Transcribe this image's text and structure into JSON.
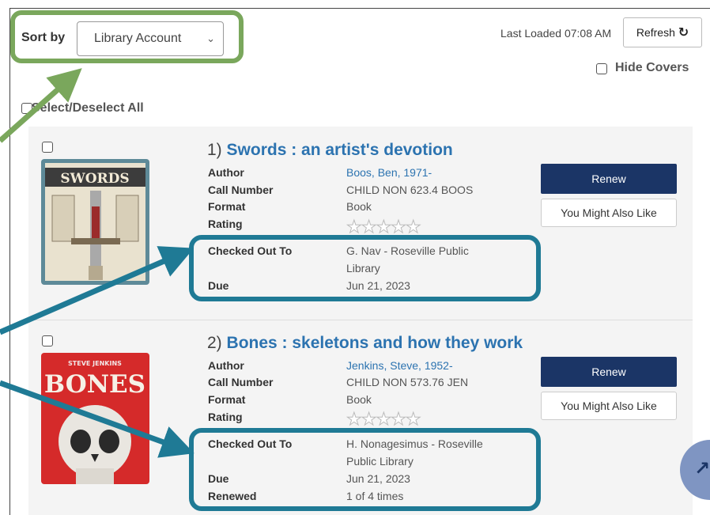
{
  "toolbar": {
    "sort_label": "Sort by",
    "sort_selected": "Library Account",
    "last_loaded": "Last Loaded 07:08 AM",
    "refresh_label": "Refresh",
    "hide_covers_label": "Hide Covers",
    "select_all_label": "Select/Deselect All"
  },
  "items": [
    {
      "number": "1)",
      "title": "Swords : an artist's devotion",
      "cover_text": "SWORDS",
      "fields": {
        "author_label": "Author",
        "author": "Boos, Ben, 1971-",
        "call_number_label": "Call Number",
        "call_number": "CHILD NON 623.4 BOOS",
        "format_label": "Format",
        "format": "Book",
        "rating_label": "Rating",
        "checked_out_to_label": "Checked Out To",
        "checked_out_to_line1": "G. Nav - Roseville Public",
        "checked_out_to_line2": "Library",
        "due_label": "Due",
        "due": "Jun 21, 2023"
      },
      "renew_label": "Renew",
      "yml_label": "You Might Also Like"
    },
    {
      "number": "2)",
      "title": "Bones : skeletons and how they work",
      "cover_text": "BONES",
      "cover_author": "STEVE JENKINS",
      "fields": {
        "author_label": "Author",
        "author": "Jenkins, Steve, 1952-",
        "call_number_label": "Call Number",
        "call_number": "CHILD NON 573.76 JEN",
        "format_label": "Format",
        "format": "Book",
        "rating_label": "Rating",
        "checked_out_to_label": "Checked Out To",
        "checked_out_to_line1": "H. Nonagesimus - Roseville",
        "checked_out_to_line2": "Public Library",
        "due_label": "Due",
        "due": "Jun 21, 2023",
        "renewed_label": "Renewed",
        "renewed": "1 of 4 times"
      },
      "renew_label": "Renew",
      "yml_label": "You Might Also Like"
    }
  ],
  "colors": {
    "accent_blue": "#2c73b0",
    "navy_button": "#1b3566",
    "annotation_green": "#7aa75c",
    "annotation_teal": "#1f7a95"
  },
  "icons": {
    "refresh": "refresh-icon",
    "select_chevron": "chevron-down-icon",
    "rating": "star-icon",
    "scroll_top": "chevron-up-icon"
  }
}
